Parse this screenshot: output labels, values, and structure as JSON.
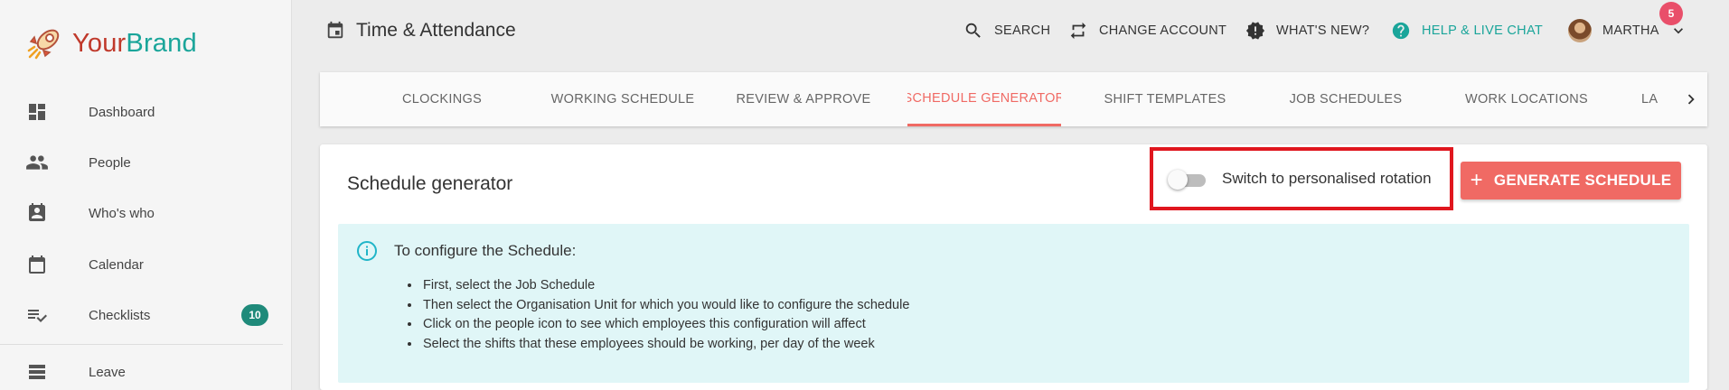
{
  "brand": {
    "part1": "Your",
    "part2": "Brand"
  },
  "sidebar": {
    "items": [
      {
        "label": "Dashboard",
        "icon": "dashboard-icon"
      },
      {
        "label": "People",
        "icon": "people-icon"
      },
      {
        "label": "Who's who",
        "icon": "contact-card-icon"
      },
      {
        "label": "Calendar",
        "icon": "calendar-icon"
      },
      {
        "label": "Checklists",
        "icon": "checklist-icon",
        "badge": "10"
      },
      {
        "label": "Leave",
        "icon": "leave-icon"
      }
    ]
  },
  "header": {
    "title": "Time & Attendance",
    "search": "SEARCH",
    "change_account": "CHANGE ACCOUNT",
    "whats_new": "WHAT'S NEW?",
    "notification_count": "5",
    "help": "HELP & LIVE CHAT",
    "user": "MARTHA"
  },
  "tabs": [
    {
      "label": "CLOCKINGS",
      "active": false
    },
    {
      "label": "WORKING SCHEDULE",
      "active": false
    },
    {
      "label": "REVIEW & APPROVE",
      "active": false
    },
    {
      "label": "SCHEDULE GENERATOR",
      "active": true
    },
    {
      "label": "SHIFT TEMPLATES",
      "active": false
    },
    {
      "label": "JOB SCHEDULES",
      "active": false
    },
    {
      "label": "WORK LOCATIONS",
      "active": false
    },
    {
      "label": "LA",
      "active": false
    }
  ],
  "card": {
    "title": "Schedule generator",
    "toggle_label": "Switch to personalised rotation",
    "toggle_on": false,
    "generate_button": "GENERATE SCHEDULE",
    "info": {
      "title": "To configure the Schedule:",
      "items": [
        "First, select the Job Schedule",
        "Then select the Organisation Unit for which you would like to configure the schedule",
        "Click on the people icon to see which employees this configuration will affect",
        "Select the shifts that these employees should be working, per day of the week"
      ]
    }
  },
  "colors": {
    "accent": "#f06a64",
    "brand_teal": "#1aa59a",
    "info_bg": "#e0f6f7",
    "highlight": "#e0161e"
  }
}
